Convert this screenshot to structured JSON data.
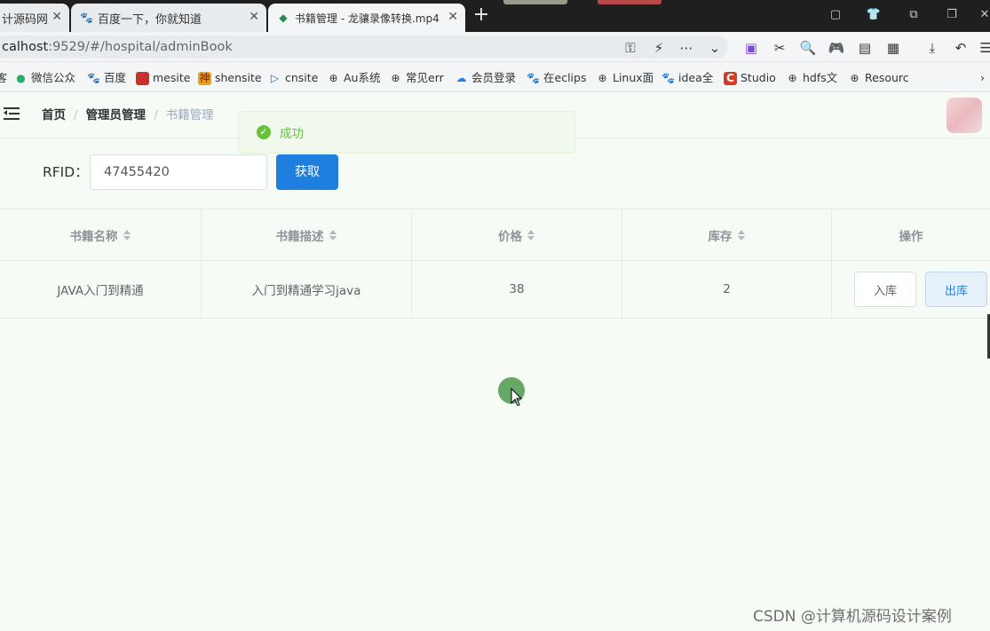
{
  "browser": {
    "tabs": [
      {
        "label": "计源码网",
        "active": false
      },
      {
        "label": "百度一下，你就知道",
        "active": false
      },
      {
        "label": "书籍管理 - 龙骧录像转换.mp4",
        "active": true
      }
    ],
    "url_host": "calhost",
    "url_rest": ":9529/#/hospital/adminBook",
    "bookmarks": [
      {
        "label": "微信公众",
        "icon": "wechat-icon"
      },
      {
        "label": "百度",
        "icon": "baidu-paw-icon"
      },
      {
        "label": "mesite",
        "icon": "red-square-icon"
      },
      {
        "label": "shensite",
        "icon": "shen-icon"
      },
      {
        "label": "cnsite",
        "icon": "play-icon"
      },
      {
        "label": "Au系统",
        "icon": "globe-icon"
      },
      {
        "label": "常见err",
        "icon": "globe-icon"
      },
      {
        "label": "会员登录",
        "icon": "cloud-icon"
      },
      {
        "label": "在eclips",
        "icon": "baidu-paw-icon"
      },
      {
        "label": "Linux面",
        "icon": "globe-icon"
      },
      {
        "label": "idea全",
        "icon": "baidu-paw-icon"
      },
      {
        "label": "Studio",
        "icon": "c-icon"
      },
      {
        "label": "hdfs文",
        "icon": "globe-icon"
      },
      {
        "label": "Resourc",
        "icon": "globe-icon"
      }
    ]
  },
  "app": {
    "breadcrumb": [
      "首页",
      "管理员管理",
      "书籍管理"
    ],
    "toast": {
      "message": "成功",
      "type": "success"
    },
    "search": {
      "label": "RFID：",
      "value": "47455420",
      "button": "获取"
    },
    "table": {
      "columns": [
        "书籍名称",
        "书籍描述",
        "价格",
        "库存",
        "操作"
      ],
      "rows": [
        {
          "name": "JAVA入门到精通",
          "desc": "入门到精通学习java",
          "price": "38",
          "stock": "2",
          "actions": [
            "入库",
            "出库"
          ]
        }
      ]
    },
    "colors": {
      "primary": "#1f7fdf",
      "success": "#67c23a",
      "background": "#f6fbf6"
    }
  },
  "watermark": "CSDN @计算机源码设计案例"
}
